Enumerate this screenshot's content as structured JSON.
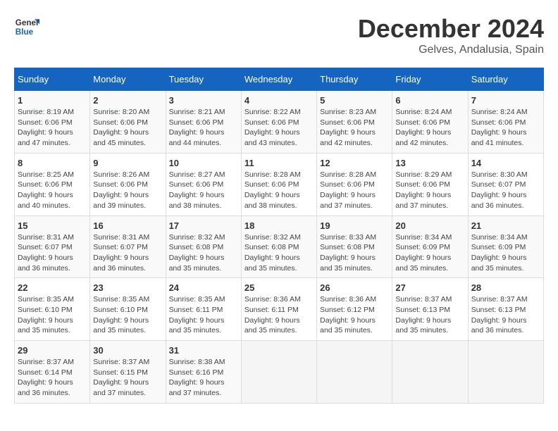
{
  "header": {
    "logo_general": "General",
    "logo_blue": "Blue",
    "month_title": "December 2024",
    "location": "Gelves, Andalusia, Spain"
  },
  "weekdays": [
    "Sunday",
    "Monday",
    "Tuesday",
    "Wednesday",
    "Thursday",
    "Friday",
    "Saturday"
  ],
  "weeks": [
    [
      {
        "day": "1",
        "sunrise": "8:19 AM",
        "sunset": "6:06 PM",
        "daylight": "9 hours and 47 minutes."
      },
      {
        "day": "2",
        "sunrise": "8:20 AM",
        "sunset": "6:06 PM",
        "daylight": "9 hours and 45 minutes."
      },
      {
        "day": "3",
        "sunrise": "8:21 AM",
        "sunset": "6:06 PM",
        "daylight": "9 hours and 44 minutes."
      },
      {
        "day": "4",
        "sunrise": "8:22 AM",
        "sunset": "6:06 PM",
        "daylight": "9 hours and 43 minutes."
      },
      {
        "day": "5",
        "sunrise": "8:23 AM",
        "sunset": "6:06 PM",
        "daylight": "9 hours and 42 minutes."
      },
      {
        "day": "6",
        "sunrise": "8:24 AM",
        "sunset": "6:06 PM",
        "daylight": "9 hours and 42 minutes."
      },
      {
        "day": "7",
        "sunrise": "8:24 AM",
        "sunset": "6:06 PM",
        "daylight": "9 hours and 41 minutes."
      }
    ],
    [
      {
        "day": "8",
        "sunrise": "8:25 AM",
        "sunset": "6:06 PM",
        "daylight": "9 hours and 40 minutes."
      },
      {
        "day": "9",
        "sunrise": "8:26 AM",
        "sunset": "6:06 PM",
        "daylight": "9 hours and 39 minutes."
      },
      {
        "day": "10",
        "sunrise": "8:27 AM",
        "sunset": "6:06 PM",
        "daylight": "9 hours and 38 minutes."
      },
      {
        "day": "11",
        "sunrise": "8:28 AM",
        "sunset": "6:06 PM",
        "daylight": "9 hours and 38 minutes."
      },
      {
        "day": "12",
        "sunrise": "8:28 AM",
        "sunset": "6:06 PM",
        "daylight": "9 hours and 37 minutes."
      },
      {
        "day": "13",
        "sunrise": "8:29 AM",
        "sunset": "6:06 PM",
        "daylight": "9 hours and 37 minutes."
      },
      {
        "day": "14",
        "sunrise": "8:30 AM",
        "sunset": "6:07 PM",
        "daylight": "9 hours and 36 minutes."
      }
    ],
    [
      {
        "day": "15",
        "sunrise": "8:31 AM",
        "sunset": "6:07 PM",
        "daylight": "9 hours and 36 minutes."
      },
      {
        "day": "16",
        "sunrise": "8:31 AM",
        "sunset": "6:07 PM",
        "daylight": "9 hours and 36 minutes."
      },
      {
        "day": "17",
        "sunrise": "8:32 AM",
        "sunset": "6:08 PM",
        "daylight": "9 hours and 35 minutes."
      },
      {
        "day": "18",
        "sunrise": "8:32 AM",
        "sunset": "6:08 PM",
        "daylight": "9 hours and 35 minutes."
      },
      {
        "day": "19",
        "sunrise": "8:33 AM",
        "sunset": "6:08 PM",
        "daylight": "9 hours and 35 minutes."
      },
      {
        "day": "20",
        "sunrise": "8:34 AM",
        "sunset": "6:09 PM",
        "daylight": "9 hours and 35 minutes."
      },
      {
        "day": "21",
        "sunrise": "8:34 AM",
        "sunset": "6:09 PM",
        "daylight": "9 hours and 35 minutes."
      }
    ],
    [
      {
        "day": "22",
        "sunrise": "8:35 AM",
        "sunset": "6:10 PM",
        "daylight": "9 hours and 35 minutes."
      },
      {
        "day": "23",
        "sunrise": "8:35 AM",
        "sunset": "6:10 PM",
        "daylight": "9 hours and 35 minutes."
      },
      {
        "day": "24",
        "sunrise": "8:35 AM",
        "sunset": "6:11 PM",
        "daylight": "9 hours and 35 minutes."
      },
      {
        "day": "25",
        "sunrise": "8:36 AM",
        "sunset": "6:11 PM",
        "daylight": "9 hours and 35 minutes."
      },
      {
        "day": "26",
        "sunrise": "8:36 AM",
        "sunset": "6:12 PM",
        "daylight": "9 hours and 35 minutes."
      },
      {
        "day": "27",
        "sunrise": "8:37 AM",
        "sunset": "6:13 PM",
        "daylight": "9 hours and 35 minutes."
      },
      {
        "day": "28",
        "sunrise": "8:37 AM",
        "sunset": "6:13 PM",
        "daylight": "9 hours and 36 minutes."
      }
    ],
    [
      {
        "day": "29",
        "sunrise": "8:37 AM",
        "sunset": "6:14 PM",
        "daylight": "9 hours and 36 minutes."
      },
      {
        "day": "30",
        "sunrise": "8:37 AM",
        "sunset": "6:15 PM",
        "daylight": "9 hours and 37 minutes."
      },
      {
        "day": "31",
        "sunrise": "8:38 AM",
        "sunset": "6:16 PM",
        "daylight": "9 hours and 37 minutes."
      },
      null,
      null,
      null,
      null
    ]
  ]
}
